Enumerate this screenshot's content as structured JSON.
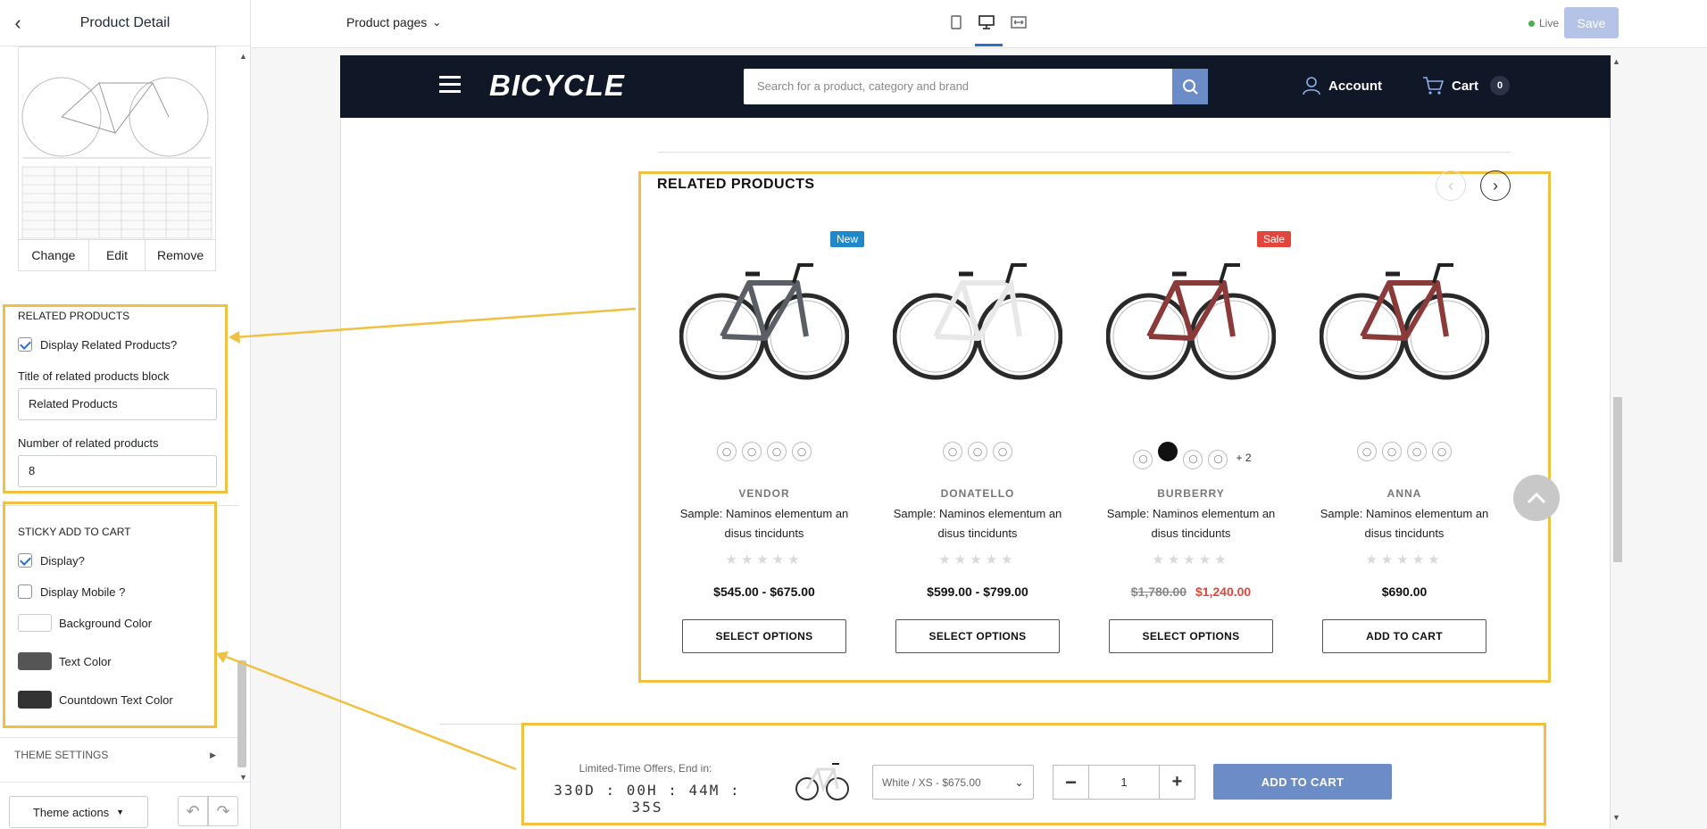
{
  "sidebar": {
    "title": "Product Detail",
    "image_actions": {
      "change": "Change",
      "edit": "Edit",
      "remove": "Remove"
    },
    "related": {
      "heading": "RELATED PRODUCTS",
      "display_label": "Display Related Products?",
      "display_checked": true,
      "title_label": "Title of related products block",
      "title_value": "Related Products",
      "count_label": "Number of related products",
      "count_value": "8"
    },
    "sticky": {
      "heading": "STICKY ADD TO CART",
      "display_label": "Display?",
      "display_checked": true,
      "mobile_label": "Display Mobile ?",
      "mobile_checked": false,
      "bg_label": "Background Color",
      "bg_color": "#ffffff",
      "text_label": "Text Color",
      "text_color": "#555555",
      "countdown_label": "Countdown Text Color",
      "countdown_color": "#333333"
    },
    "theme_settings": "THEME SETTINGS",
    "theme_actions": "Theme actions"
  },
  "topbar": {
    "page_select": "Product pages",
    "live": "Live",
    "save": "Save"
  },
  "shop": {
    "logo": "BICYCLE",
    "search_placeholder": "Search for a product, category and brand",
    "account": "Account",
    "cart": "Cart",
    "cart_count": "0"
  },
  "related": {
    "title": "RELATED PRODUCTS",
    "products": [
      {
        "vendor": "VENDOR",
        "name": "Sample: Naminos elementum an disus tincidunts",
        "price": "$545.00 - $675.00",
        "old_price": "",
        "button": "SELECT OPTIONS",
        "badge": "New"
      },
      {
        "vendor": "DONATELLO",
        "name": "Sample: Naminos elementum an disus tincidunts",
        "price": "$599.00 - $799.00",
        "old_price": "",
        "button": "SELECT OPTIONS",
        "badge": ""
      },
      {
        "vendor": "BURBERRY",
        "name": "Sample: Naminos elementum an disus tincidunts",
        "price": "$1,240.00",
        "old_price": "$1,780.00",
        "button": "SELECT OPTIONS",
        "badge": "Sale",
        "more": "+ 2"
      },
      {
        "vendor": "ANNA",
        "name": "Sample: Naminos elementum an disus tincidunts",
        "price": "$690.00",
        "old_price": "",
        "button": "ADD TO CART",
        "badge": ""
      }
    ]
  },
  "sticky_bar": {
    "offer_label": "Limited-Time Offers, End in:",
    "countdown": "330D : 00H : 44M : 35S",
    "variant": "White / XS - $675.00",
    "qty": "1",
    "add": "ADD TO CART"
  },
  "colors": {
    "accent": "#f0c040",
    "header": "#101727",
    "save": "#b4c3e6",
    "sale": "#e2453c",
    "new": "#1e88c8",
    "add_btn": "#6c8cc8"
  }
}
